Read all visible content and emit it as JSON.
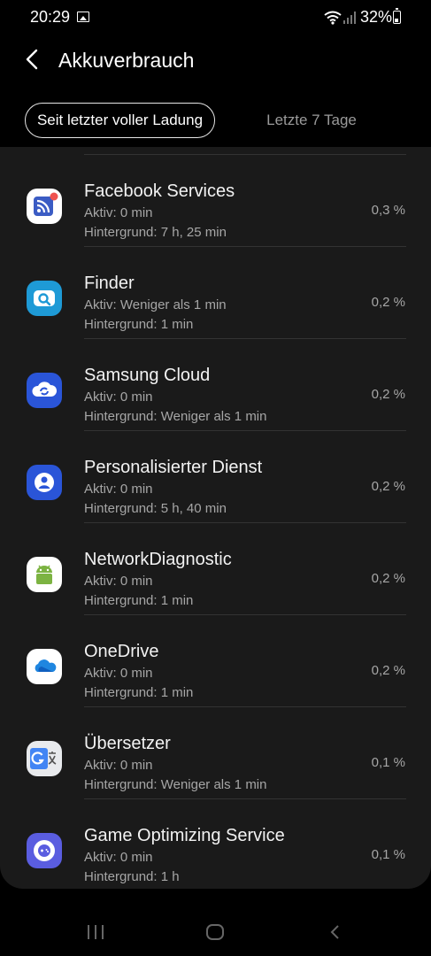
{
  "status_bar": {
    "time": "20:29",
    "battery": "32%"
  },
  "header": {
    "title": "Akkuverbrauch"
  },
  "tabs": [
    {
      "label": "Seit letzter voller Ladung",
      "selected": true
    },
    {
      "label": "Letzte 7 Tage",
      "selected": false
    }
  ],
  "apps": [
    {
      "name": "Facebook Services",
      "active": "Aktiv: 0 min",
      "background": "Hintergrund: 7 h, 25 min",
      "percent": "0,3 %",
      "icon": "facebook-services-icon"
    },
    {
      "name": "Finder",
      "active": "Aktiv: Weniger als 1 min",
      "background": "Hintergrund: 1 min",
      "percent": "0,2 %",
      "icon": "finder-icon"
    },
    {
      "name": "Samsung Cloud",
      "active": "Aktiv: 0 min",
      "background": "Hintergrund: Weniger als 1 min",
      "percent": "0,2 %",
      "icon": "samsung-cloud-icon"
    },
    {
      "name": "Personalisierter Dienst",
      "active": "Aktiv: 0 min",
      "background": "Hintergrund: 5 h, 40 min",
      "percent": "0,2 %",
      "icon": "personalized-service-icon"
    },
    {
      "name": "NetworkDiagnostic",
      "active": "Aktiv: 0 min",
      "background": "Hintergrund: 1 min",
      "percent": "0,2 %",
      "icon": "android-icon"
    },
    {
      "name": "OneDrive",
      "active": "Aktiv: 0 min",
      "background": "Hintergrund: 1 min",
      "percent": "0,2 %",
      "icon": "onedrive-icon"
    },
    {
      "name": "Übersetzer",
      "active": "Aktiv: 0 min",
      "background": "Hintergrund: Weniger als 1 min",
      "percent": "0,1 %",
      "icon": "translate-icon"
    },
    {
      "name": "Game Optimizing Service",
      "active": "Aktiv: 0 min",
      "background": "Hintergrund: 1 h",
      "percent": "0,1 %",
      "icon": "game-optimizing-icon"
    }
  ]
}
